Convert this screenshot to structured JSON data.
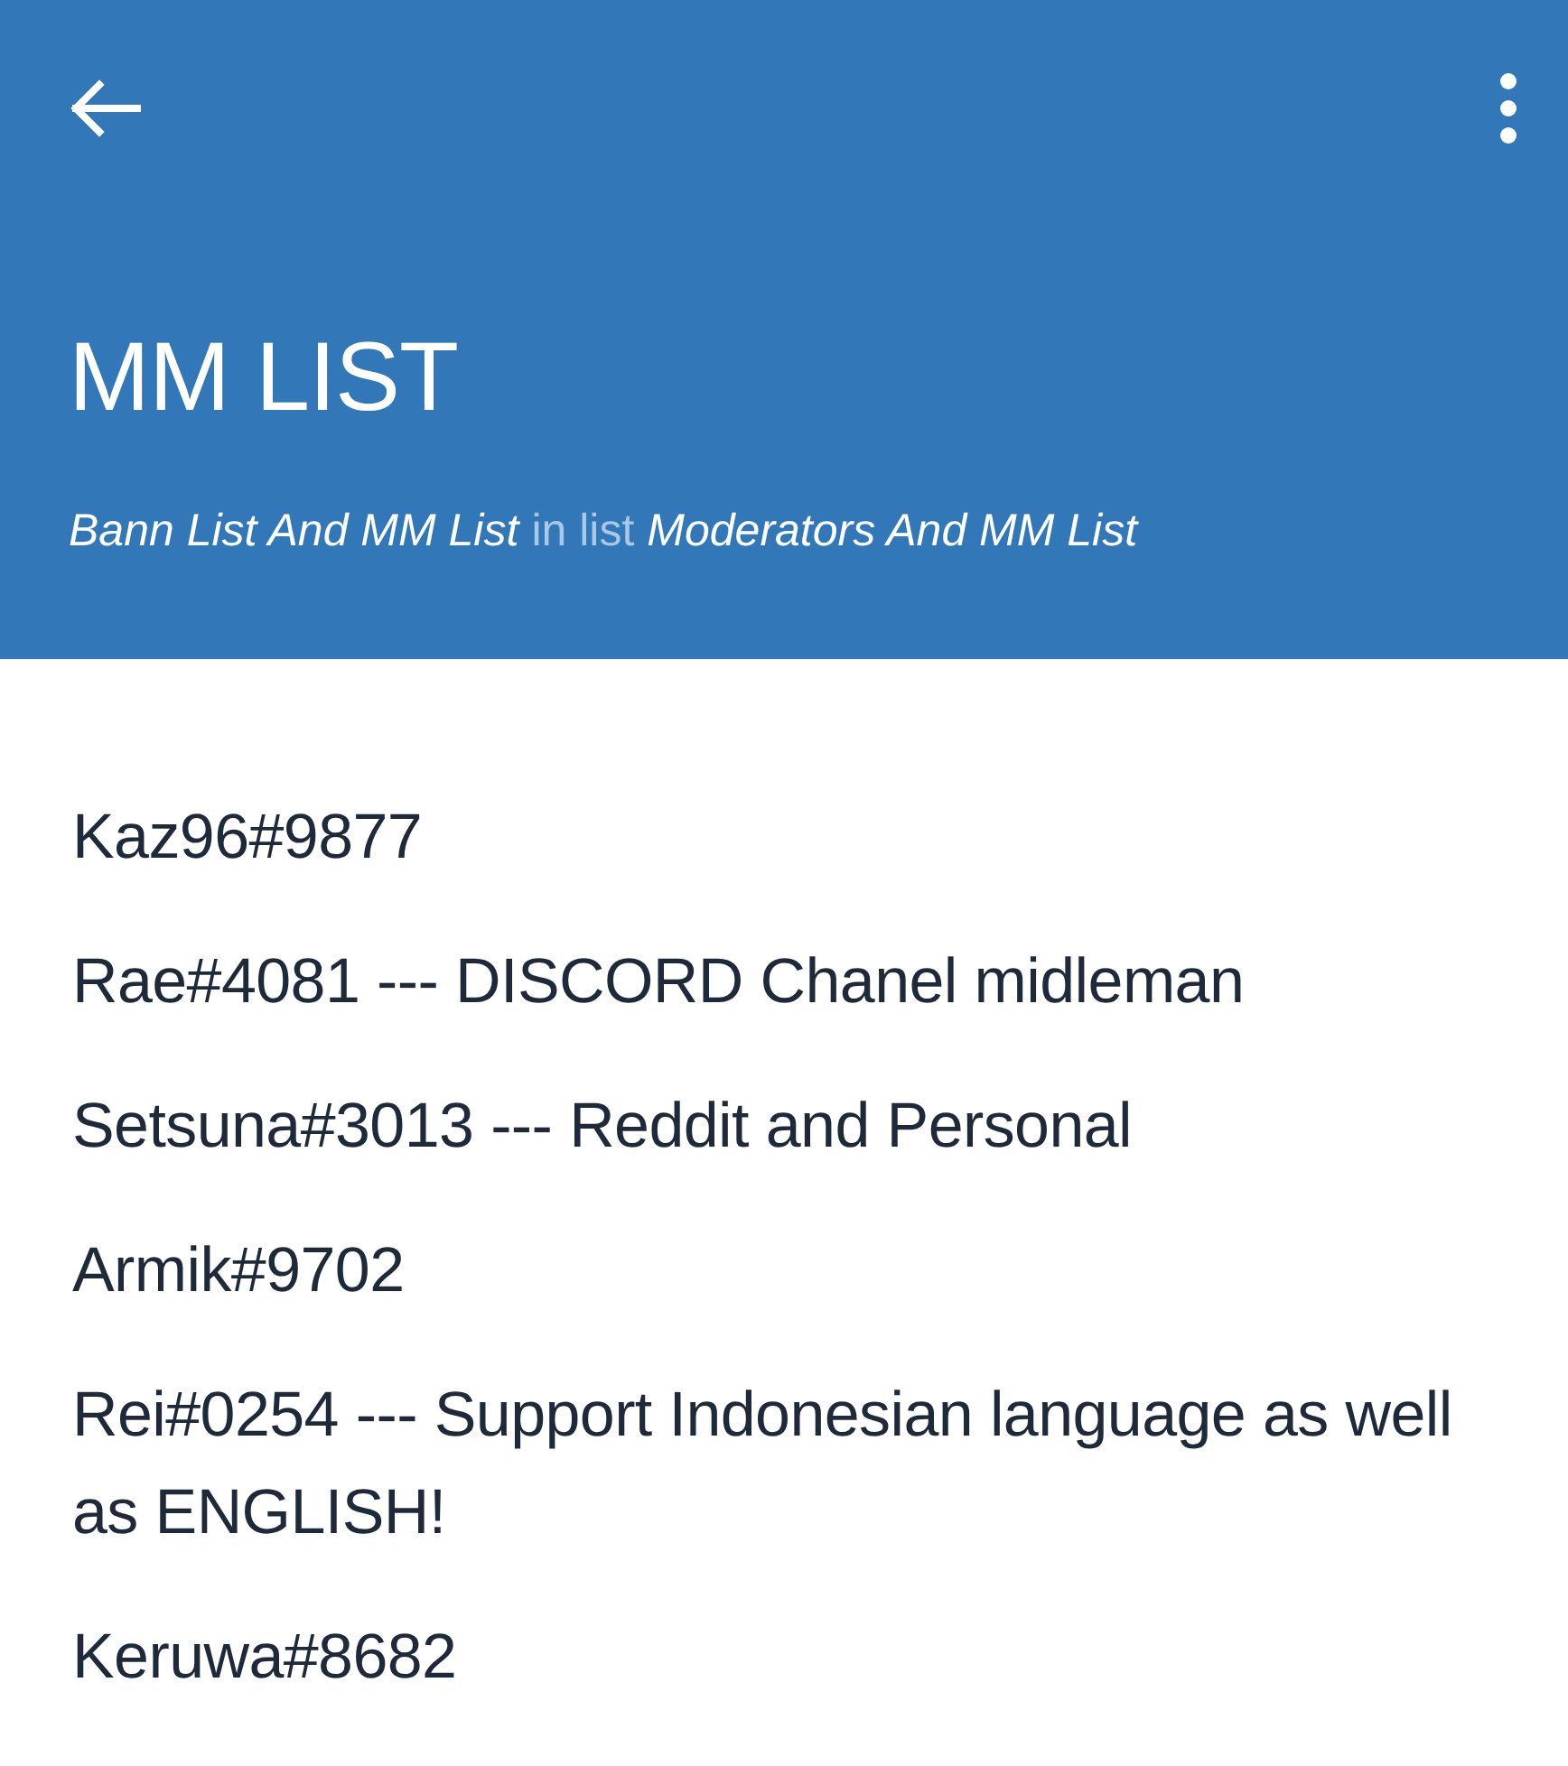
{
  "header": {
    "title": "MM LIST",
    "board": "Bann List And MM List",
    "separator": "in list",
    "list": "Moderators And MM List"
  },
  "lines": [
    {
      "text": "Kaz96#9877"
    },
    {
      "text": "Rae#4081 --- DISCORD Chanel midleman"
    },
    {
      "text": "Setsuna#3013 --- Reddit and Personal"
    },
    {
      "text": "Armik#9702"
    },
    {
      "text": "Rei#0254 --- Support Indonesian language as well as ENGLISH!"
    },
    {
      "text": "Keruwa#8682"
    }
  ]
}
